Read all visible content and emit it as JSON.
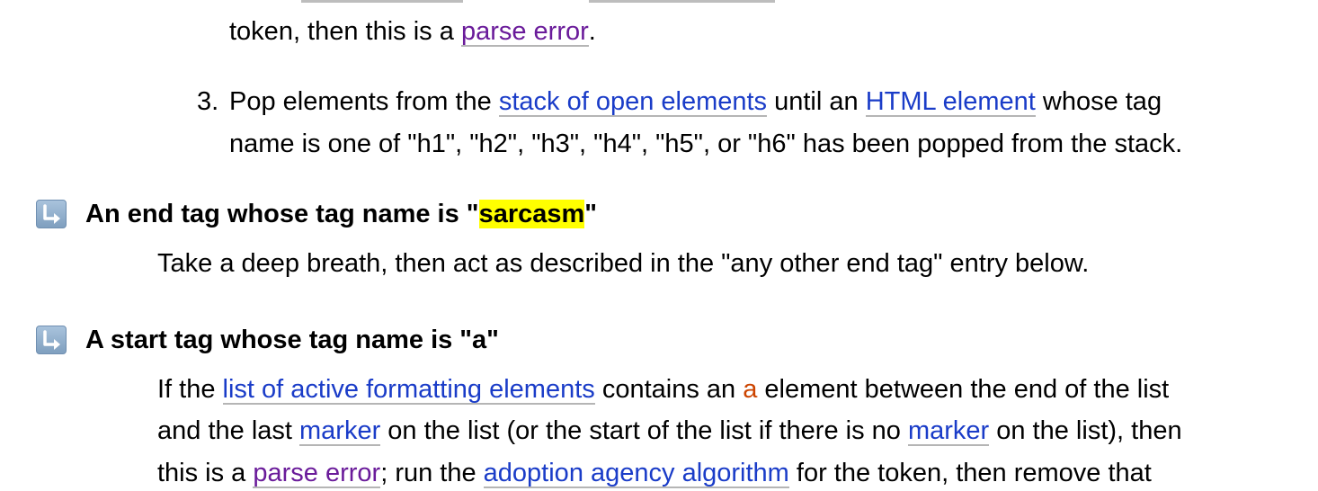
{
  "list_item_2_tail": {
    "before": "token, then this is a ",
    "link": "parse error",
    "after": "."
  },
  "list_item_3": {
    "number": "3.",
    "text1": "Pop elements from the ",
    "link1": "stack of open elements",
    "text2": " until an ",
    "link2": "HTML element",
    "text3": " whose tag",
    "line2": "name is one of \"h1\", \"h2\", \"h3\", \"h4\", \"h5\", or \"h6\" has been popped from the stack."
  },
  "sarcasm_entry": {
    "term_before": "An end tag whose tag name is \"",
    "term_highlight": "sarcasm",
    "term_after": "\"",
    "description": "Take a deep breath, then act as described in the \"any other end tag\" entry below."
  },
  "a_entry": {
    "term": "A start tag whose tag name is \"a\"",
    "l1_text1": "If the ",
    "l1_link": "list of active formatting elements",
    "l1_text2": " contains an ",
    "l1_code": "a",
    "l1_text3": " element between the end of the list",
    "l2_text1": "and the last ",
    "l2_link1": "marker",
    "l2_text2": " on the list (or the start of the list if there is no ",
    "l2_link2": "marker",
    "l2_text3": " on the list), then",
    "l3_text1": "this is a ",
    "l3_link1": "parse error",
    "l3_text2": "; run the ",
    "l3_link2": "adoption agency algorithm",
    "l3_text3": " for the token, then remove that"
  },
  "icons": {
    "entry_marker": "return-arrow-icon"
  },
  "colors": {
    "link": "#1a3cc8",
    "visited_link": "#6a1b9a",
    "code": "#cc4400",
    "highlight": "#ffff00"
  }
}
